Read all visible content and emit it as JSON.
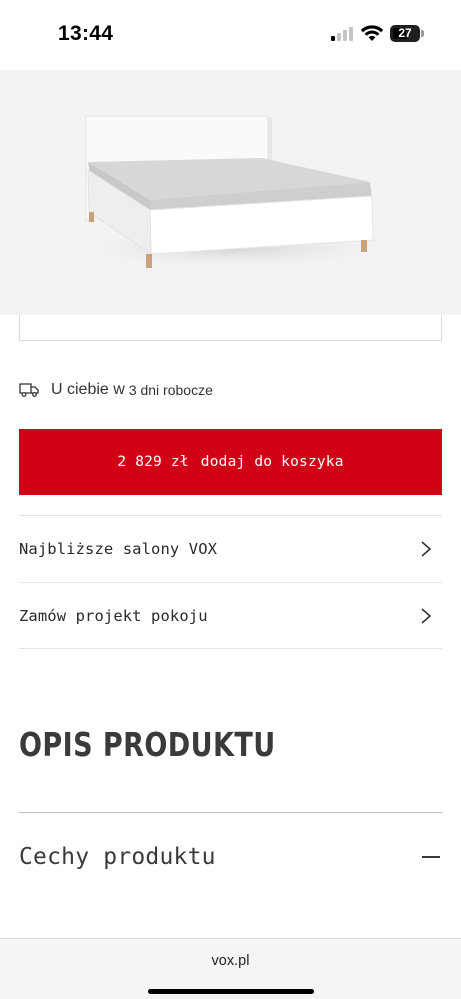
{
  "status_bar": {
    "time": "13:44",
    "battery_level": "27",
    "icons": [
      "signal-icon",
      "wifi-icon",
      "battery-icon"
    ]
  },
  "product": {
    "image_icon": "bed-image",
    "delivery": {
      "text": "U ciebie w",
      "days": "3 dni robocze",
      "icon": "truck-icon"
    },
    "add_to_cart": {
      "price": "2 829 zł",
      "label": "dodaj do koszyka",
      "color": "#d10016"
    }
  },
  "links": [
    {
      "label": "Najbliższe salony VOX",
      "icon": "chevron-right-icon"
    },
    {
      "label": "Zamów projekt pokoju",
      "icon": "chevron-right-icon"
    }
  ],
  "description": {
    "title": "OPIS PRODUKTU",
    "features_label": "Cechy produktu",
    "features_icon": "minus-icon"
  },
  "browser": {
    "url": "vox.pl"
  }
}
